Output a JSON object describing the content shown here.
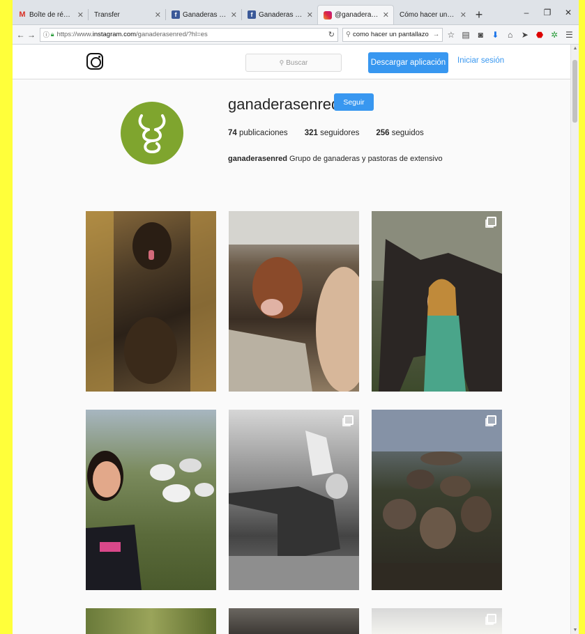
{
  "browser": {
    "tabs": [
      {
        "label": "Boîte de réception - l",
        "icon": "gmail-icon",
        "color": "#d93025",
        "active": false
      },
      {
        "label": "Transfer",
        "icon": "none",
        "color": "",
        "active": false
      },
      {
        "label": "Ganaderas en Red - In",
        "icon": "facebook-icon",
        "color": "#3b5998",
        "active": false
      },
      {
        "label": "Ganaderas en Red - In",
        "icon": "facebook-icon",
        "color": "#3b5998",
        "active": false
      },
      {
        "label": "@ganaderasenred • F",
        "icon": "instagram-icon",
        "color": "#c13584",
        "active": true
      },
      {
        "label": "Cómo hacer una captura",
        "icon": "none",
        "color": "",
        "active": false
      }
    ],
    "url_prefix": "https://www.",
    "url_host": "instagram.com",
    "url_path": "/ganaderasenred/?hl=es",
    "search_text": "como hacer un pantallazo"
  },
  "instagram": {
    "search_placeholder": "Buscar",
    "download_label": "Descargar aplicación",
    "login_label": "Iniciar sesión",
    "profile": {
      "username": "ganaderasenred",
      "follow_label": "Seguir",
      "posts_count": "74",
      "posts_label": "publicaciones",
      "followers_count": "321",
      "followers_label": "seguidores",
      "following_count": "256",
      "following_label": "seguidos",
      "bio_name": "ganaderasenred",
      "bio_text": "Grupo de ganaderas y pastoras de extensivo"
    }
  },
  "colors": {
    "accent": "#3897f0",
    "avatar_bg": "#7fa52e",
    "background_outer": "#ffff3a"
  }
}
